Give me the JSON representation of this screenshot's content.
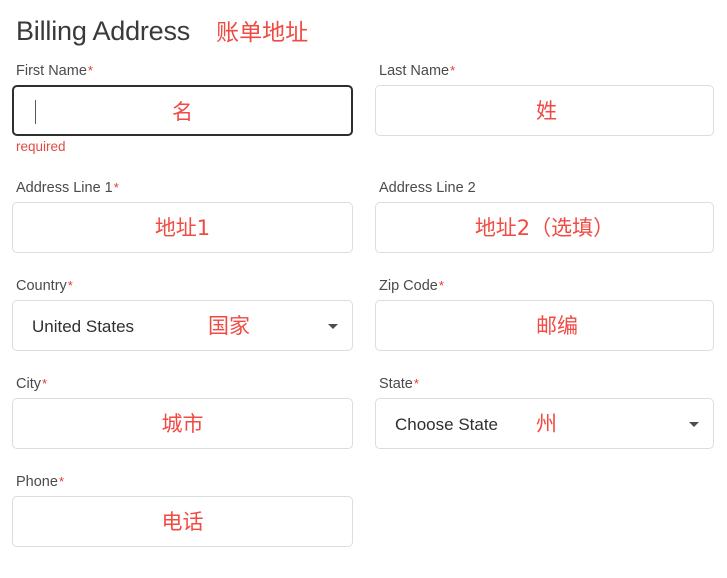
{
  "header": {
    "title": "Billing Address",
    "annotation": "账单地址"
  },
  "fields": {
    "first_name": {
      "label": "First Name",
      "required_marker": "*",
      "annotation": "名",
      "value": "",
      "error": "required"
    },
    "last_name": {
      "label": "Last Name",
      "required_marker": "*",
      "annotation": "姓",
      "value": ""
    },
    "address_line_1": {
      "label": "Address Line 1",
      "required_marker": "*",
      "annotation": "地址1",
      "value": ""
    },
    "address_line_2": {
      "label": "Address Line 2",
      "required_marker": "",
      "annotation": "地址2（选填）",
      "value": ""
    },
    "country": {
      "label": "Country",
      "required_marker": "*",
      "annotation": "国家",
      "selected": "United States"
    },
    "zip_code": {
      "label": "Zip Code",
      "required_marker": "*",
      "annotation": "邮编",
      "value": ""
    },
    "city": {
      "label": "City",
      "required_marker": "*",
      "annotation": "城市",
      "value": ""
    },
    "state": {
      "label": "State",
      "required_marker": "*",
      "annotation": "州",
      "selected": "Choose State"
    },
    "phone": {
      "label": "Phone",
      "required_marker": "*",
      "annotation": "电话",
      "value": ""
    }
  },
  "colors": {
    "annotation_red": "#f04a42",
    "error_red": "#e14a43",
    "asterisk_red": "#e8362c",
    "focus_border": "#2e2e2e",
    "idle_border": "#dddddd"
  }
}
